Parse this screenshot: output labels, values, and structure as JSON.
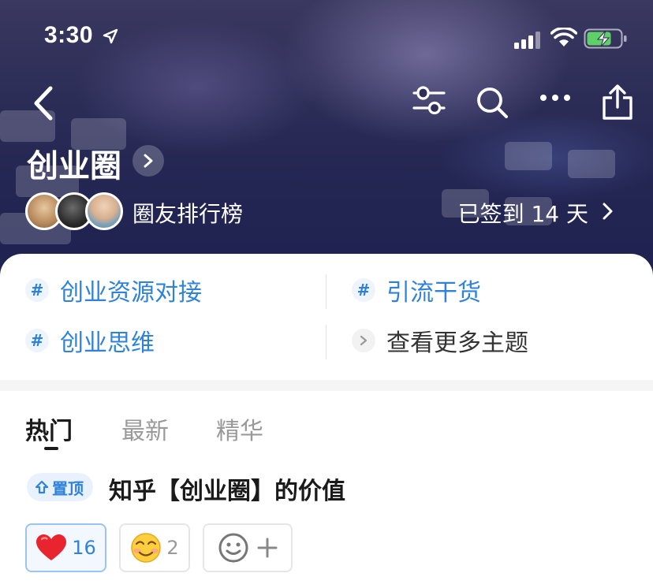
{
  "status_bar": {
    "time": "3:30"
  },
  "circle": {
    "title": "创业圈",
    "leaderboard_label": "圈友排行榜",
    "checkin_label": "已签到 14 天"
  },
  "topics": [
    {
      "label": "创业资源对接"
    },
    {
      "label": "引流干货"
    },
    {
      "label": "创业思维"
    }
  ],
  "more_topics_label": "查看更多主题",
  "tabs": [
    {
      "label": "热门",
      "active": true
    },
    {
      "label": "最新",
      "active": false
    },
    {
      "label": "精华",
      "active": false
    }
  ],
  "pinned_post": {
    "badge": "置顶",
    "title": "知乎【创业圈】的价值"
  },
  "reactions": [
    {
      "icon": "heart-icon",
      "count": "16"
    },
    {
      "icon": "smiling-face-icon",
      "count": "2"
    }
  ],
  "colors": {
    "accent": "#2f82d9",
    "header_bg": "#262855"
  }
}
